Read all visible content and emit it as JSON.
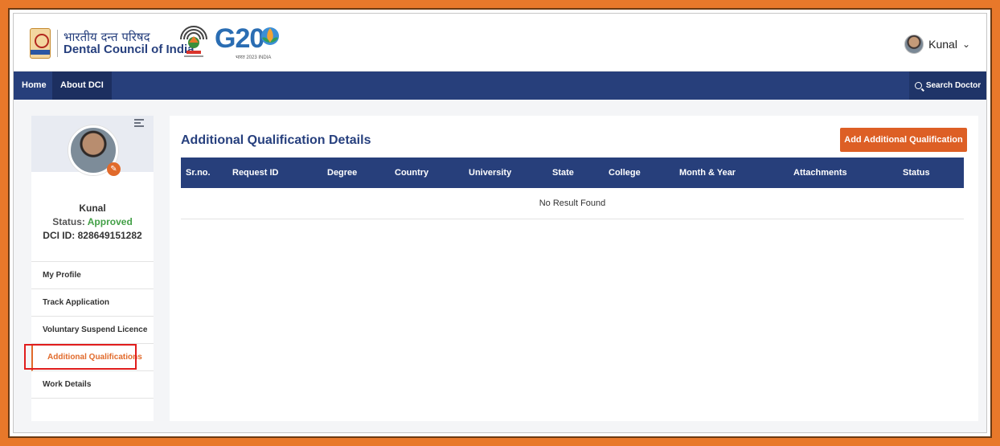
{
  "header": {
    "brand_hindi": "भारतीय दन्त परिषद",
    "brand_english": "Dental Council of India",
    "g20_text": "G20",
    "g20_tagline": "भारत 2023 INDIA",
    "user_name": "Kunal"
  },
  "nav": {
    "home_label": "Home",
    "about_label": "About DCI",
    "search_label": "Search Doctor"
  },
  "sidebar": {
    "name": "Kunal",
    "status_label": "Status:",
    "status_value": "Approved",
    "dci_id": "DCI ID: 828649151282",
    "items": [
      {
        "label": "My Profile"
      },
      {
        "label": "Track Application"
      },
      {
        "label": "Voluntary Suspend Licence"
      },
      {
        "label": "Additional Qualifications",
        "active": true
      },
      {
        "label": "Work Details"
      }
    ]
  },
  "main": {
    "title": "Additional Qualification Details",
    "add_button_label": "Add Additional Qualification",
    "table": {
      "headers": [
        "Sr.no.",
        "Request ID",
        "Degree",
        "Country",
        "University",
        "State",
        "College",
        "Month & Year",
        "Attachments",
        "Status"
      ],
      "empty_message": "No Result Found"
    }
  },
  "colors": {
    "frame_orange": "#e8782a",
    "nav_navy": "#273f7b",
    "accent_orange": "#dd5f25",
    "approved_green": "#43a047",
    "highlight_red": "#e11d1d"
  },
  "icons": [
    "dci-emblem-icon",
    "campaign-logo-icon",
    "g20-logo-icon",
    "chevron-down-icon",
    "search-icon",
    "collapse-menu-icon",
    "edit-pencil-icon"
  ]
}
